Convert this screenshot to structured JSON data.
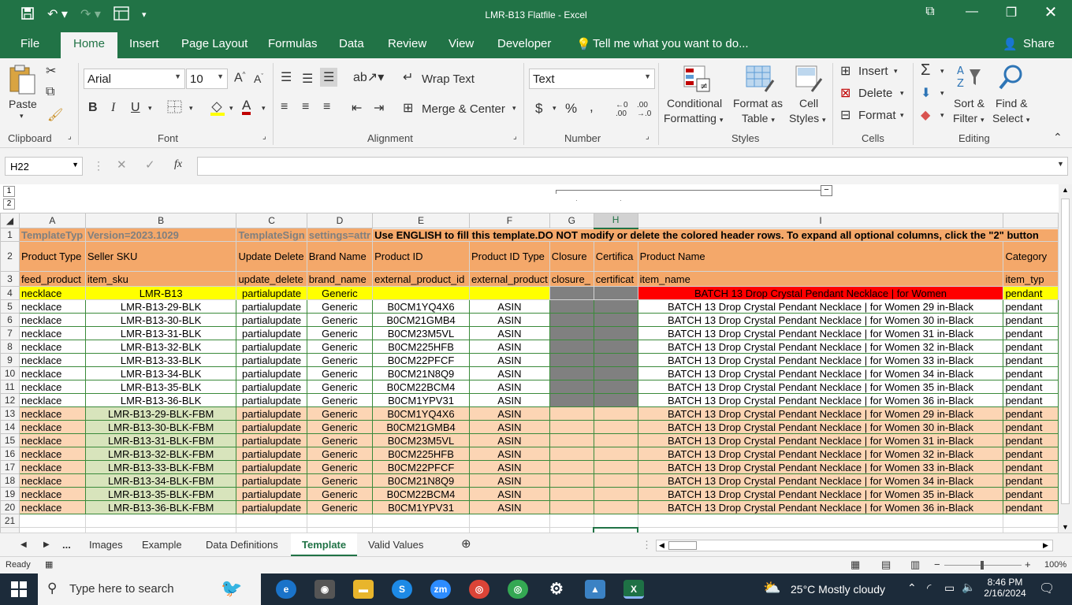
{
  "window": {
    "title": "LMR-B13 Flatfile - Excel",
    "share_label": "Share"
  },
  "menu": {
    "file": "File",
    "home": "Home",
    "insert": "Insert",
    "page_layout": "Page Layout",
    "formulas": "Formulas",
    "data": "Data",
    "review": "Review",
    "view": "View",
    "developer": "Developer",
    "tell_me": "Tell me what you want to do..."
  },
  "ribbon": {
    "paste": "Paste",
    "font_name": "Arial",
    "font_size": "10",
    "wrap_text": "Wrap Text",
    "merge_center": "Merge & Center",
    "number_format": "Text",
    "conditional_formatting_1": "Conditional",
    "conditional_formatting_2": "Formatting",
    "format_as_table_1": "Format as",
    "format_as_table_2": "Table",
    "cell_styles_1": "Cell",
    "cell_styles_2": "Styles",
    "insert": "Insert",
    "delete": "Delete",
    "format": "Format",
    "sort_filter_1": "Sort &",
    "sort_filter_2": "Filter",
    "find_select_1": "Find &",
    "find_select_2": "Select",
    "groups": {
      "clipboard": "Clipboard",
      "font": "Font",
      "alignment": "Alignment",
      "number": "Number",
      "styles": "Styles",
      "cells": "Cells",
      "editing": "Editing"
    }
  },
  "formula_bar": {
    "name_box": "H22",
    "fx": "fx",
    "content": ""
  },
  "outline_levels": [
    "1",
    "2"
  ],
  "columns": [
    "A",
    "B",
    "C",
    "D",
    "E",
    "F",
    "G",
    "H",
    "I"
  ],
  "selected_column": "H",
  "sheet": {
    "row1": {
      "a": "TemplateTyp",
      "b": "Version=2023.1029",
      "c": "TemplateSign",
      "d": "settings=attr",
      "instructions": "Use ENGLISH to fill this template.DO NOT modify or delete the colored header rows. To expand all optional columns, click the \"2\" button"
    },
    "row2": [
      "Product Type",
      "Seller SKU",
      "Update Delete",
      "Brand Name",
      "Product ID",
      "Product ID Type",
      "Closure",
      "Certifica",
      "Product Name",
      "Category"
    ],
    "row3": [
      "feed_product",
      "item_sku",
      "update_delete",
      "brand_name",
      "external_product_id",
      "external_product",
      "closure_",
      "certificat",
      "item_name",
      "item_typ"
    ],
    "row4": [
      "necklace",
      "LMR-B13",
      "partialupdate",
      "Generic",
      "",
      "",
      "",
      "",
      "BATCH 13 Drop Crystal Pendant Necklace | for Women",
      "pendant"
    ],
    "rows": [
      [
        "necklace",
        "LMR-B13-29-BLK",
        "partialupdate",
        "Generic",
        "B0CM1YQ4X6",
        "ASIN",
        "BATCH 13 Drop Crystal Pendant Necklace | for Women 29 in-Black",
        "pendant"
      ],
      [
        "necklace",
        "LMR-B13-30-BLK",
        "partialupdate",
        "Generic",
        "B0CM21GMB4",
        "ASIN",
        "BATCH 13 Drop Crystal Pendant Necklace | for Women 30 in-Black",
        "pendant"
      ],
      [
        "necklace",
        "LMR-B13-31-BLK",
        "partialupdate",
        "Generic",
        "B0CM23M5VL",
        "ASIN",
        "BATCH 13 Drop Crystal Pendant Necklace | for Women 31 in-Black",
        "pendant"
      ],
      [
        "necklace",
        "LMR-B13-32-BLK",
        "partialupdate",
        "Generic",
        "B0CM225HFB",
        "ASIN",
        "BATCH 13 Drop Crystal Pendant Necklace | for Women 32 in-Black",
        "pendant"
      ],
      [
        "necklace",
        "LMR-B13-33-BLK",
        "partialupdate",
        "Generic",
        "B0CM22PFCF",
        "ASIN",
        "BATCH 13 Drop Crystal Pendant Necklace | for Women 33 in-Black",
        "pendant"
      ],
      [
        "necklace",
        "LMR-B13-34-BLK",
        "partialupdate",
        "Generic",
        "B0CM21N8Q9",
        "ASIN",
        "BATCH 13 Drop Crystal Pendant Necklace | for Women 34 in-Black",
        "pendant"
      ],
      [
        "necklace",
        "LMR-B13-35-BLK",
        "partialupdate",
        "Generic",
        "B0CM22BCM4",
        "ASIN",
        "BATCH 13 Drop Crystal Pendant Necklace | for Women 35 in-Black",
        "pendant"
      ],
      [
        "necklace",
        "LMR-B13-36-BLK",
        "partialupdate",
        "Generic",
        "B0CM1YPV31",
        "ASIN",
        "BATCH 13 Drop Crystal Pendant Necklace | for Women 36 in-Black",
        "pendant"
      ],
      [
        "necklace",
        "LMR-B13-29-BLK-FBM",
        "partialupdate",
        "Generic",
        "B0CM1YQ4X6",
        "ASIN",
        "BATCH 13 Drop Crystal Pendant Necklace | for Women 29 in-Black",
        "pendant"
      ],
      [
        "necklace",
        "LMR-B13-30-BLK-FBM",
        "partialupdate",
        "Generic",
        "B0CM21GMB4",
        "ASIN",
        "BATCH 13 Drop Crystal Pendant Necklace | for Women 30 in-Black",
        "pendant"
      ],
      [
        "necklace",
        "LMR-B13-31-BLK-FBM",
        "partialupdate",
        "Generic",
        "B0CM23M5VL",
        "ASIN",
        "BATCH 13 Drop Crystal Pendant Necklace | for Women 31 in-Black",
        "pendant"
      ],
      [
        "necklace",
        "LMR-B13-32-BLK-FBM",
        "partialupdate",
        "Generic",
        "B0CM225HFB",
        "ASIN",
        "BATCH 13 Drop Crystal Pendant Necklace | for Women 32 in-Black",
        "pendant"
      ],
      [
        "necklace",
        "LMR-B13-33-BLK-FBM",
        "partialupdate",
        "Generic",
        "B0CM22PFCF",
        "ASIN",
        "BATCH 13 Drop Crystal Pendant Necklace | for Women 33 in-Black",
        "pendant"
      ],
      [
        "necklace",
        "LMR-B13-34-BLK-FBM",
        "partialupdate",
        "Generic",
        "B0CM21N8Q9",
        "ASIN",
        "BATCH 13 Drop Crystal Pendant Necklace | for Women 34 in-Black",
        "pendant"
      ],
      [
        "necklace",
        "LMR-B13-35-BLK-FBM",
        "partialupdate",
        "Generic",
        "B0CM22BCM4",
        "ASIN",
        "BATCH 13 Drop Crystal Pendant Necklace | for Women 35 in-Black",
        "pendant"
      ],
      [
        "necklace",
        "LMR-B13-36-BLK-FBM",
        "partialupdate",
        "Generic",
        "B0CM1YPV31",
        "ASIN",
        "BATCH 13 Drop Crystal Pendant Necklace | for Women 36 in-Black",
        "pendant"
      ]
    ],
    "row_numbers": [
      "1",
      "2",
      "3",
      "4",
      "5",
      "6",
      "7",
      "8",
      "9",
      "10",
      "11",
      "12",
      "13",
      "14",
      "15",
      "16",
      "17",
      "18",
      "19",
      "20",
      "21"
    ]
  },
  "sheet_tabs": {
    "more": "...",
    "tabs": [
      "Images",
      "Example",
      "Data Definitions",
      "Template",
      "Valid Values"
    ],
    "active": "Template"
  },
  "status": {
    "ready": "Ready",
    "zoom": "100%"
  },
  "taskbar": {
    "search_placeholder": "Type here to search",
    "weather": "25°C  Mostly cloudy",
    "time": "8:46 PM",
    "date": "2/16/2024"
  },
  "colors": {
    "excel_green": "#217346",
    "header_orange": "#f4a86a",
    "row4_yellow": "#ffff00",
    "row4_red": "#ff0000",
    "dark_gray": "#808080",
    "fbm_peach": "#fcd5b4",
    "fbm_green": "#d8e4bc"
  }
}
